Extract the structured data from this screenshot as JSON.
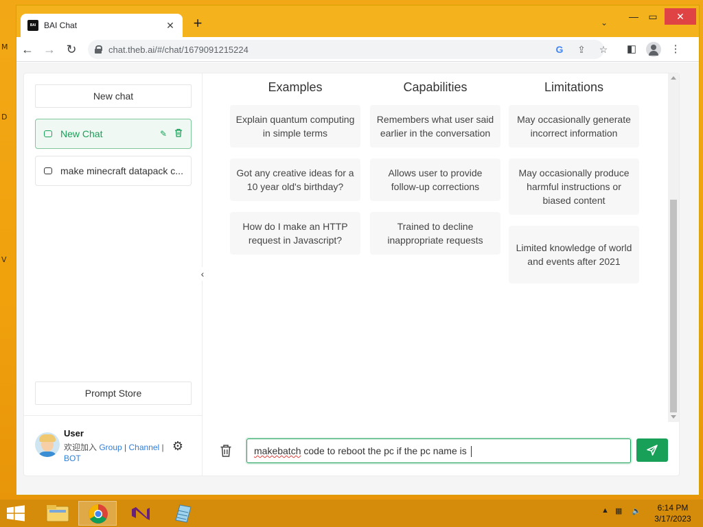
{
  "desktop": {
    "edge_letters": [
      "M",
      "D",
      "V"
    ]
  },
  "browser": {
    "tab": {
      "title": "BAI Chat",
      "favicon": "BAI"
    },
    "url": "chat.theb.ai/#/chat/1679091215224",
    "window_controls": {
      "minimize": "—",
      "maximize": "▭",
      "close": "✕"
    }
  },
  "sidebar": {
    "new_chat_label": "New chat",
    "chats": [
      {
        "label": "New Chat",
        "active": true
      },
      {
        "label": "make minecraft datapack c...",
        "active": false
      }
    ],
    "prompt_store_label": "Prompt Store",
    "user": {
      "name": "User",
      "subtitle_prefix": "欢迎加入 ",
      "group_link": "Group",
      "sep1": " | ",
      "channel_link": "Channel",
      "sep2": " |",
      "bot_link": "BOT"
    }
  },
  "main": {
    "columns": [
      {
        "heading": "Examples",
        "cards": [
          "Explain quantum computing in simple terms",
          "Got any creative ideas for a 10 year old's birthday?",
          "How do I make an HTTP request in Javascript?"
        ]
      },
      {
        "heading": "Capabilities",
        "cards": [
          "Remembers what user said earlier in the conversation",
          "Allows user to provide follow-up corrections",
          "Trained to decline inappropriate requests"
        ]
      },
      {
        "heading": "Limitations",
        "cards": [
          "May occasionally generate incorrect information",
          "May occasionally produce harmful instructions or biased content",
          "Limited knowledge of world and events after 2021"
        ]
      }
    ],
    "input": {
      "misspelled_word": "makebatch",
      "rest": " code to reboot the pc if the pc name is "
    }
  },
  "taskbar": {
    "apps": [
      "file-explorer",
      "chrome",
      "visual-studio",
      "notepad"
    ],
    "clock": {
      "time": "6:14 PM",
      "date": "3/17/2023"
    }
  },
  "colors": {
    "accent": "#18a058",
    "desktop": "#f0a30a",
    "taskbar": "#d48c0a",
    "link": "#2f7ed8"
  }
}
